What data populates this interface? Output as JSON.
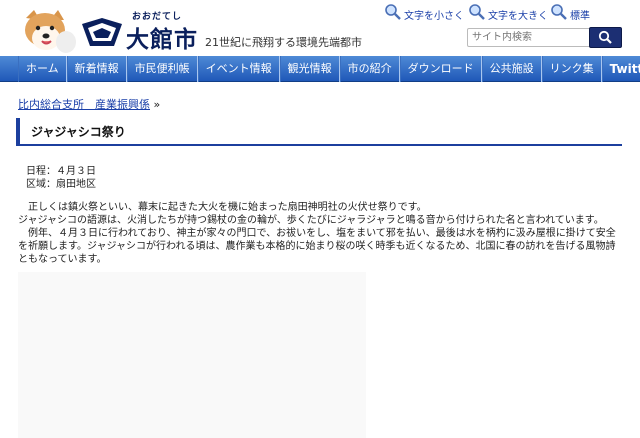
{
  "header": {
    "logo_kana": "おおだてし",
    "city_name": "大館市",
    "tagline": "21世紀に飛翔する環境先端都市",
    "font_size_links": [
      {
        "label": "文字を小さく",
        "icon": "magnifier-icon"
      },
      {
        "label": "文字を大きく",
        "icon": "magnifier-icon"
      },
      {
        "label": "標準",
        "icon": "magnifier-icon"
      }
    ],
    "search": {
      "placeholder": "サイト内検索",
      "button_icon": "search-icon"
    }
  },
  "nav": {
    "items": [
      {
        "label": "ホーム"
      },
      {
        "label": "新着情報"
      },
      {
        "label": "市民便利帳"
      },
      {
        "label": "イベント情報"
      },
      {
        "label": "観光情報"
      },
      {
        "label": "市の紹介"
      },
      {
        "label": "ダウンロード"
      },
      {
        "label": "公共施設"
      },
      {
        "label": "リンク集"
      },
      {
        "label": "Twitter"
      }
    ]
  },
  "breadcrumb": {
    "link": "比内総合支所　産業振興係",
    "separator": "»"
  },
  "page": {
    "title": "ジャジャシコ祭り",
    "date_line": "日程：４月３日",
    "area_line": "区域：扇田地区",
    "paragraphs": [
      "　正しくは鎮火祭といい、幕末に起きた大火を機に始まった扇田神明社の火伏せ祭りです。",
      "ジャジャシコの語源は、火消したちが持つ錫杖の金の輪が、歩くたびにジャラジャラと鳴る音から付けられた名と言われています。",
      "　例年、４月３日に行われており、神主が家々の門口で、お祓いをし、塩をまいて邪を払い、最後は水を柄杓に汲み屋根に掛けて安全を祈願します。ジャジャシコが行われる頃は、農作業も本格的に始まり桜の咲く時季も近くなるため、北国に春の訪れを告げる風物詩ともなっています。"
    ]
  },
  "colors": {
    "nav": "#2f6cc7",
    "accent": "#1c3f9e",
    "search_button": "#1c2f73"
  }
}
